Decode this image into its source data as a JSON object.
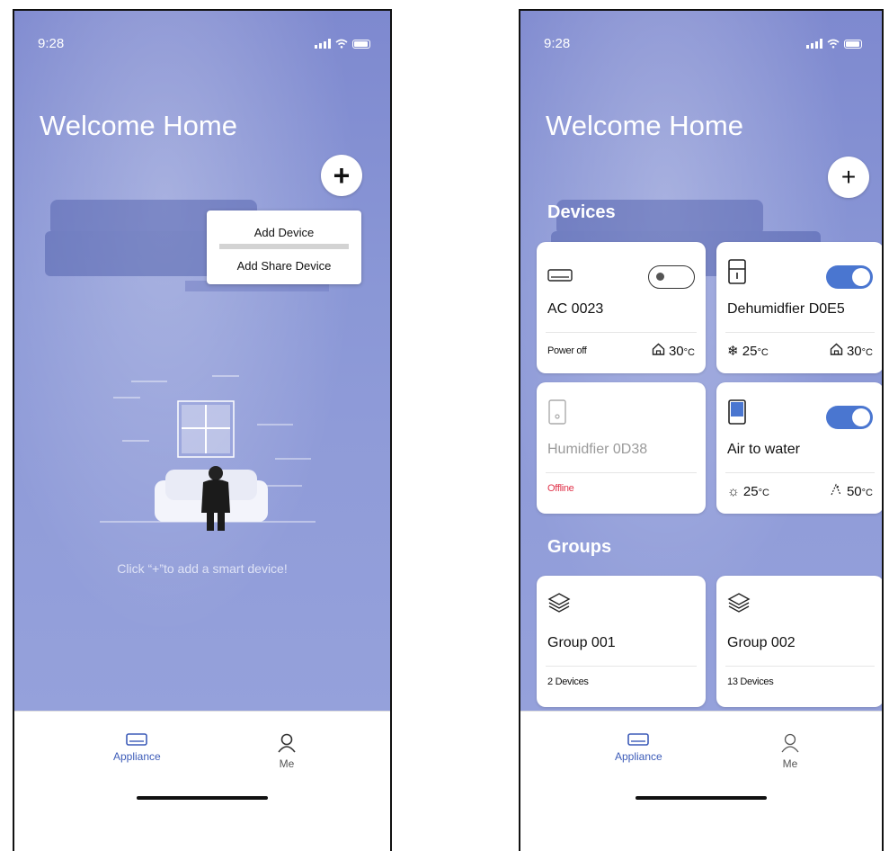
{
  "screens": {
    "left": {
      "status": {
        "time": "9:28"
      },
      "title": "Welcome Home",
      "add_button": "+",
      "menu": {
        "items": [
          "Add Device",
          "Add Share Device"
        ]
      },
      "empty_hint": "Click “+”to add a smart device!",
      "tabs": [
        {
          "label": "Appliance",
          "active": true
        },
        {
          "label": "Me",
          "active": false
        }
      ]
    },
    "right": {
      "status": {
        "time": "9:28"
      },
      "title": "Welcome Home",
      "add_button": "+",
      "devices_heading": "Devices",
      "devices": [
        {
          "name": "AC 0023",
          "icon": "ac-unit-icon",
          "toggle": "off",
          "status": "Power off",
          "status_color": "#111111",
          "temp_right": "30",
          "temp_right_unit": "°C",
          "temp_right_icon": "home-icon"
        },
        {
          "name": "Dehumidfier D0E5",
          "icon": "dehumidifier-icon",
          "toggle": "on",
          "temp_left": "25",
          "temp_left_unit": "°C",
          "temp_left_icon": "snowflake-icon",
          "temp_right": "30",
          "temp_right_unit": "°C",
          "temp_right_icon": "home-icon"
        },
        {
          "name": "Humidfier 0D38",
          "icon": "humidifier-icon",
          "toggle": "none",
          "status": "Offline",
          "status_color": "#e0334a"
        },
        {
          "name": "Air to water",
          "icon": "heat-pump-icon",
          "toggle": "on",
          "temp_left": "25",
          "temp_left_unit": "°C",
          "temp_left_icon": "sun-icon",
          "temp_right": "50",
          "temp_right_unit": "°C",
          "temp_right_icon": "water-icon"
        }
      ],
      "groups_heading": "Groups",
      "groups": [
        {
          "name": "Group 001",
          "count": "2 Devices",
          "icon": "layers-icon"
        },
        {
          "name": "Group 002",
          "count": "13 Devices",
          "icon": "layers-icon"
        }
      ],
      "tabs": [
        {
          "label": "Appliance",
          "active": true
        },
        {
          "label": "Me",
          "active": false
        }
      ]
    }
  },
  "colors": {
    "accent": "#3d5cb8",
    "toggle_on": "#4a76d0",
    "offline": "#e0334a",
    "background": "#8a97d6"
  }
}
